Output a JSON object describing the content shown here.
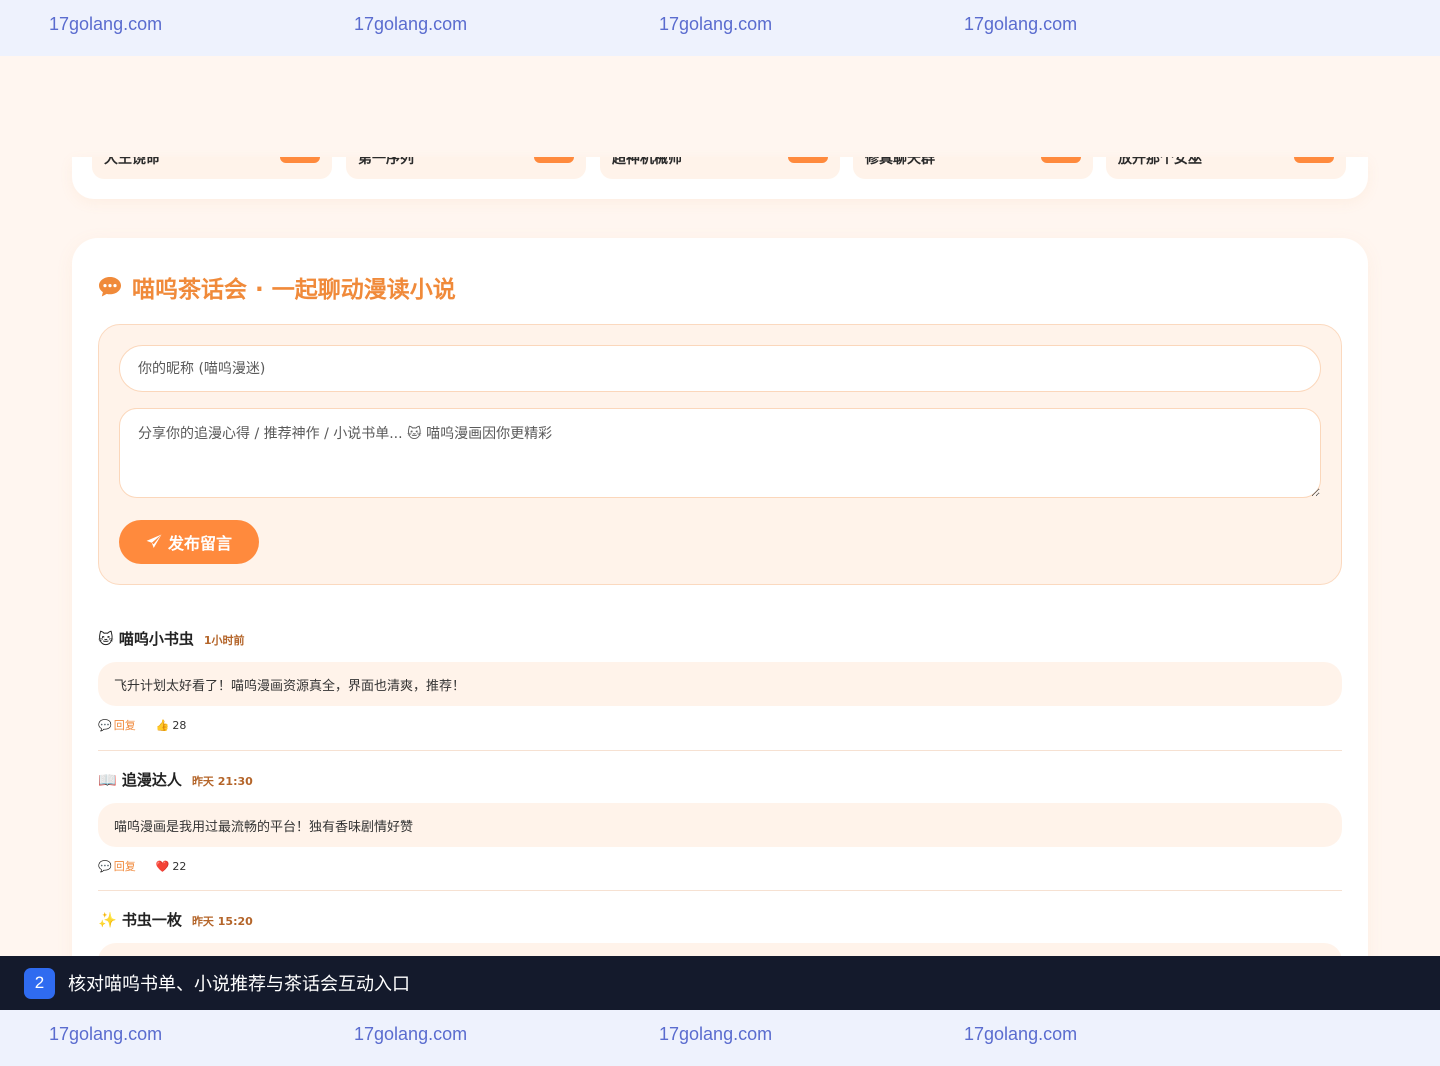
{
  "watermark": {
    "text": "17golang.com"
  },
  "top_ranking": {
    "items": [
      {
        "name": "大王饶命",
        "badge_icon": "badge-pill"
      },
      {
        "name": "第一序列",
        "badge_icon": "badge-pill"
      },
      {
        "name": "超神机械师",
        "badge_icon": "badge-pill"
      },
      {
        "name": "修真聊天群",
        "badge_icon": "badge-pill"
      },
      {
        "name": "放开那个女巫",
        "badge_icon": "badge-pill"
      }
    ]
  },
  "guestbook": {
    "title": "喵呜茶话会 · 一起聊动漫读小说",
    "title_icon": "chat-bubble-icon",
    "nickname_placeholder": "你的昵称 (喵呜漫迷)",
    "message_placeholder": "分享你的追漫心得 / 推荐神作 / 小说书单... 🐱 喵呜漫画因你更精彩",
    "submit_label": "发布留言",
    "submit_icon": "paper-plane-icon"
  },
  "comments": [
    {
      "avatar": "🐱",
      "author": "喵呜小书虫",
      "time": "1小时前",
      "body": "飞升计划太好看了！喵呜漫画资源真全，界面也清爽，推荐！",
      "reply_label": "回复",
      "like_icon": "👍",
      "like_count": "28"
    },
    {
      "avatar": "📖",
      "author": "追漫达人",
      "time": "昨天 21:30",
      "body": "喵呜漫画是我用过最流畅的平台！独有香味剧情好赞",
      "reply_label": "回复",
      "like_icon": "❤️",
      "like_count": "22"
    },
    {
      "avatar": "✨",
      "author": "书虫一枚",
      "time": "昨天 15:20"
    }
  ],
  "caption": {
    "step": "2",
    "text": "核对喵呜书单、小说推荐与茶话会互动入口"
  },
  "colors": {
    "accent": "#ff8a3d",
    "title": "#f08a3a",
    "page_bg": "#fff6f0",
    "caption_bg": "#141a2c",
    "step_badge": "#2f6bf0"
  }
}
